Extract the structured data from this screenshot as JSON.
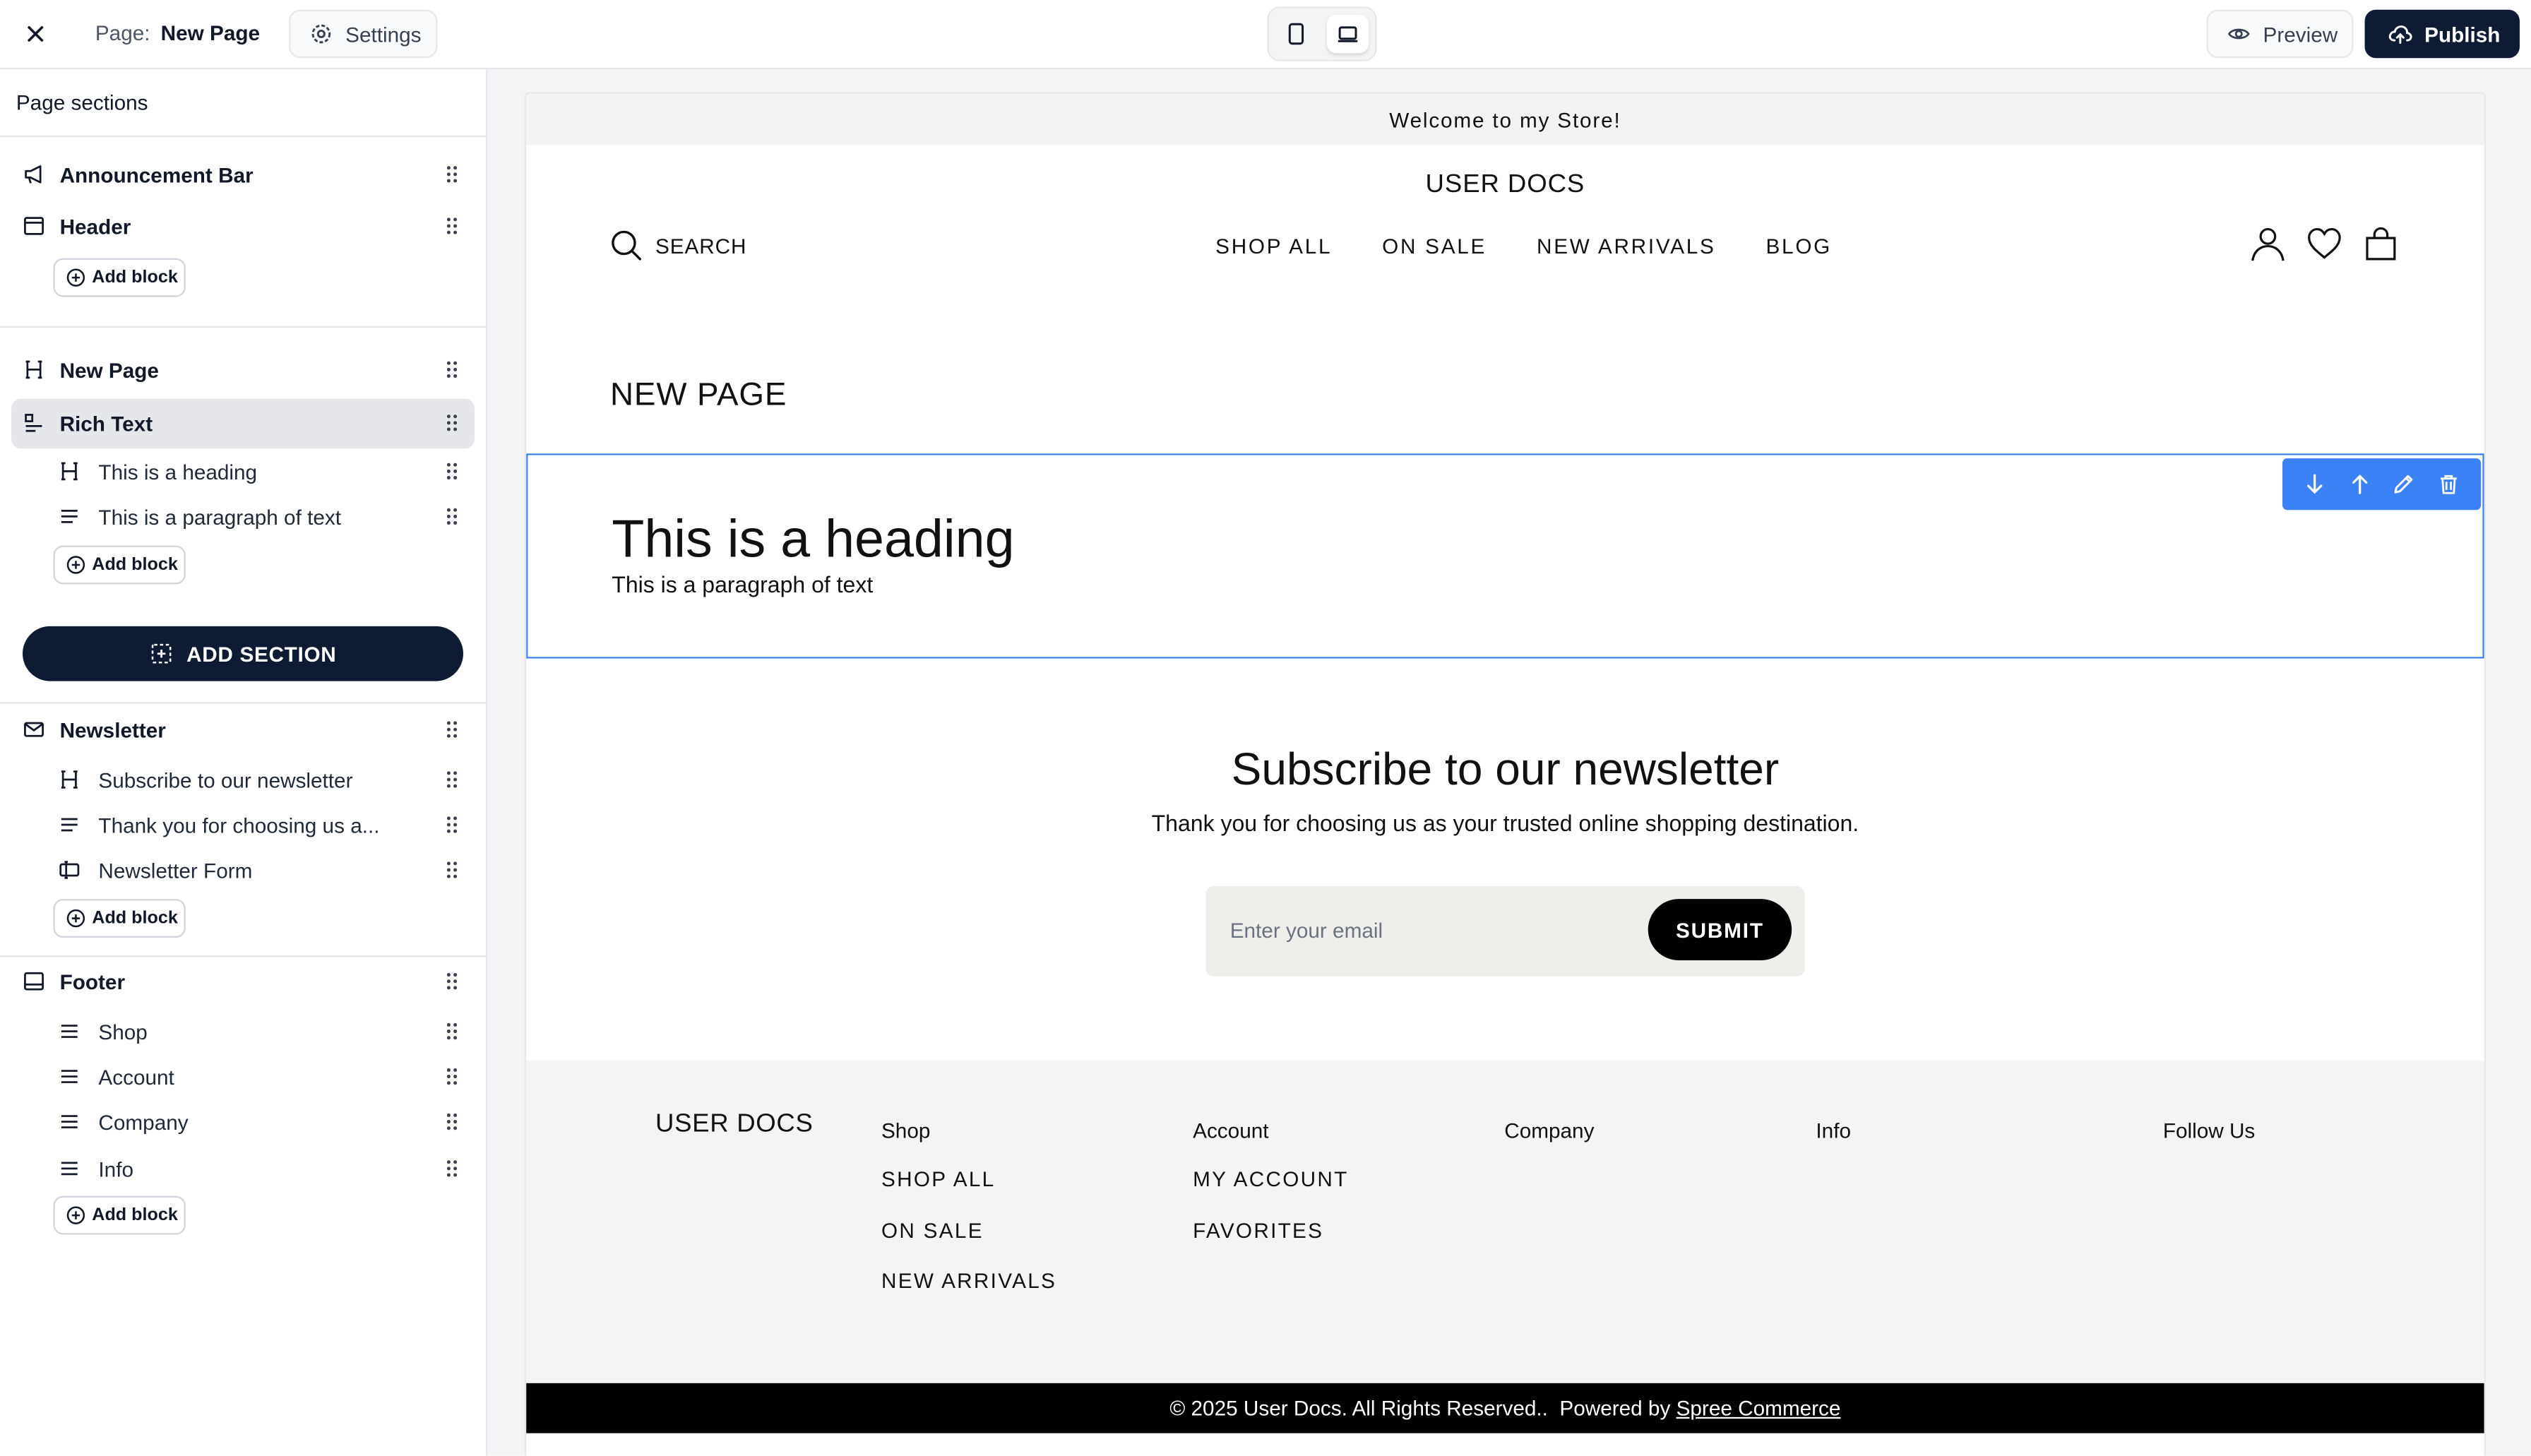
{
  "topbar": {
    "page_label": "Page:",
    "page_name": "New Page",
    "settings_label": "Settings",
    "preview_label": "Preview",
    "publish_label": "Publish",
    "active_device": "desktop"
  },
  "sidebar": {
    "title": "Page sections",
    "add_block_label": "Add block",
    "add_section_label": "ADD SECTION",
    "sections": {
      "announcement": "Announcement Bar",
      "header": "Header",
      "new_page": "New Page",
      "rich_text": "Rich Text",
      "rich_text_blocks": [
        "This is a heading",
        "This is a paragraph of text"
      ],
      "newsletter": "Newsletter",
      "newsletter_blocks": [
        "Subscribe to our newsletter",
        "Thank you for choosing us a...",
        "Newsletter Form"
      ],
      "footer": "Footer",
      "footer_blocks": [
        "Shop",
        "Account",
        "Company",
        "Info"
      ]
    },
    "selected": "Rich Text"
  },
  "preview": {
    "announcement": "Welcome to my Store!",
    "store_name": "USER DOCS",
    "search_label": "SEARCH",
    "nav": [
      "SHOP ALL",
      "ON SALE",
      "NEW ARRIVALS",
      "BLOG"
    ],
    "page_title": "NEW PAGE",
    "rich_text": {
      "heading": "This is a heading",
      "paragraph": "This is a paragraph of text"
    },
    "newsletter": {
      "title": "Subscribe to our newsletter",
      "text": "Thank you for choosing us as your trusted online shopping destination.",
      "placeholder": "Enter your email",
      "submit": "SUBMIT"
    },
    "footer": {
      "brand": "USER DOCS",
      "columns": [
        {
          "head": "Shop",
          "links": [
            "SHOP ALL",
            "ON SALE",
            "NEW ARRIVALS"
          ]
        },
        {
          "head": "Account",
          "links": [
            "MY ACCOUNT",
            "FAVORITES"
          ]
        },
        {
          "head": "Company",
          "links": []
        },
        {
          "head": "Info",
          "links": []
        },
        {
          "head": "Follow Us",
          "links": []
        }
      ],
      "copyright": "© 2025 User Docs. All Rights Reserved..  Powered by ",
      "powered_link": "Spree Commerce"
    }
  },
  "colors": {
    "primary_dark": "#0f1b33",
    "selection_blue": "#3b82f6"
  }
}
